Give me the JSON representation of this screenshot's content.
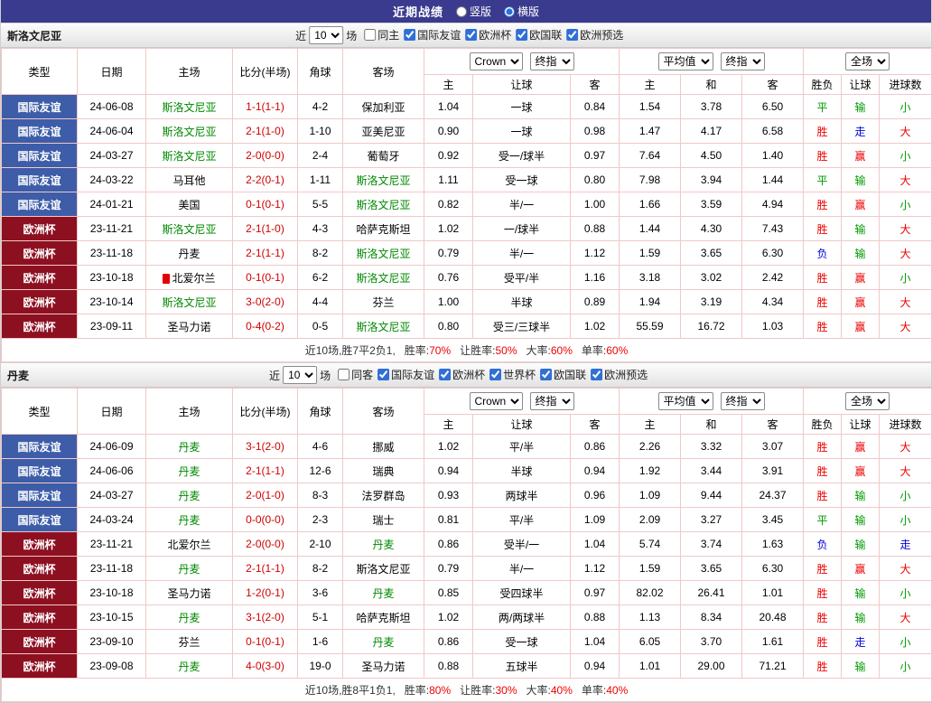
{
  "topbar": {
    "title": "近期战绩",
    "layout_options": [
      {
        "label": "竖版",
        "selected": false
      },
      {
        "label": "横版",
        "selected": true
      }
    ]
  },
  "table_header": {
    "col_type": "类型",
    "col_date": "日期",
    "col_home": "主场",
    "col_score": "比分(半场)",
    "col_corner": "角球",
    "col_away": "客场",
    "handicap_group": {
      "bookmaker": "Crown",
      "price_type": "终指",
      "sub_home": "主",
      "sub_line": "让球",
      "sub_away": "客"
    },
    "average_group": {
      "name": "平均值",
      "price_type": "终指",
      "sub_home": "主",
      "sub_draw": "和",
      "sub_away": "客"
    },
    "result_group": {
      "scope": "全场",
      "sub_wdl": "胜负",
      "sub_handicap": "让球",
      "sub_goals": "进球数"
    }
  },
  "colors": {
    "topbar_bg": "#3a3a8e",
    "badge_friendly": "#3d5da9",
    "badge_eurocup": "#8d1021",
    "focus_team": "#008800",
    "score": "#d10000",
    "win_red": "#ee0000",
    "lose_green": "#009900",
    "draw_blue": "#0000d9"
  },
  "sections": [
    {
      "team": "斯洛文尼亚",
      "filter": {
        "prefix": "近",
        "count": "10",
        "suffix": "场",
        "checkboxes": [
          {
            "label": "同主",
            "checked": false
          },
          {
            "label": "国际友谊",
            "checked": true
          },
          {
            "label": "欧洲杯",
            "checked": true
          },
          {
            "label": "欧国联",
            "checked": true
          },
          {
            "label": "欧洲预选",
            "checked": true
          }
        ]
      },
      "rows": [
        {
          "type": "国际友谊",
          "type_color": "blue",
          "date": "24-06-08",
          "home": "斯洛文尼亚",
          "home_focus": true,
          "score": "1-1(1-1)",
          "corners": "4-2",
          "away": "保加利亚",
          "away_focus": false,
          "crown_home": "1.04",
          "handicap": "一球",
          "crown_away": "0.84",
          "avg_home": "1.54",
          "avg_draw": "3.78",
          "avg_away": "6.50",
          "res_wdl": "平",
          "res_handicap": "输",
          "res_goals": "小"
        },
        {
          "type": "国际友谊",
          "type_color": "blue",
          "date": "24-06-04",
          "home": "斯洛文尼亚",
          "home_focus": true,
          "score": "2-1(1-0)",
          "corners": "1-10",
          "away": "亚美尼亚",
          "away_focus": false,
          "crown_home": "0.90",
          "handicap": "一球",
          "crown_away": "0.98",
          "avg_home": "1.47",
          "avg_draw": "4.17",
          "avg_away": "6.58",
          "res_wdl": "胜",
          "res_handicap": "走",
          "res_goals": "大"
        },
        {
          "type": "国际友谊",
          "type_color": "blue",
          "date": "24-03-27",
          "home": "斯洛文尼亚",
          "home_focus": true,
          "score": "2-0(0-0)",
          "corners": "2-4",
          "away": "葡萄牙",
          "away_focus": false,
          "crown_home": "0.92",
          "handicap": "受一/球半",
          "crown_away": "0.97",
          "avg_home": "7.64",
          "avg_draw": "4.50",
          "avg_away": "1.40",
          "res_wdl": "胜",
          "res_handicap": "赢",
          "res_goals": "小"
        },
        {
          "type": "国际友谊",
          "type_color": "blue",
          "date": "24-03-22",
          "home": "马耳他",
          "home_focus": false,
          "score": "2-2(0-1)",
          "corners": "1-11",
          "away": "斯洛文尼亚",
          "away_focus": true,
          "crown_home": "1.11",
          "handicap": "受一球",
          "crown_away": "0.80",
          "avg_home": "7.98",
          "avg_draw": "3.94",
          "avg_away": "1.44",
          "res_wdl": "平",
          "res_handicap": "输",
          "res_goals": "大"
        },
        {
          "type": "国际友谊",
          "type_color": "blue",
          "date": "24-01-21",
          "home": "美国",
          "home_focus": false,
          "score": "0-1(0-1)",
          "corners": "5-5",
          "away": "斯洛文尼亚",
          "away_focus": true,
          "crown_home": "0.82",
          "handicap": "半/一",
          "crown_away": "1.00",
          "avg_home": "1.66",
          "avg_draw": "3.59",
          "avg_away": "4.94",
          "res_wdl": "胜",
          "res_handicap": "赢",
          "res_goals": "小"
        },
        {
          "type": "欧洲杯",
          "type_color": "darkred",
          "date": "23-11-21",
          "home": "斯洛文尼亚",
          "home_focus": true,
          "score": "2-1(1-0)",
          "corners": "4-3",
          "away": "哈萨克斯坦",
          "away_focus": false,
          "crown_home": "1.02",
          "handicap": "一/球半",
          "crown_away": "0.88",
          "avg_home": "1.44",
          "avg_draw": "4.30",
          "avg_away": "7.43",
          "res_wdl": "胜",
          "res_handicap": "输",
          "res_goals": "大"
        },
        {
          "type": "欧洲杯",
          "type_color": "darkred",
          "date": "23-11-18",
          "home": "丹麦",
          "home_focus": false,
          "score": "2-1(1-1)",
          "corners": "8-2",
          "away": "斯洛文尼亚",
          "away_focus": true,
          "crown_home": "0.79",
          "handicap": "半/一",
          "crown_away": "1.12",
          "avg_home": "1.59",
          "avg_draw": "3.65",
          "avg_away": "6.30",
          "res_wdl": "负",
          "res_handicap": "输",
          "res_goals": "大"
        },
        {
          "type": "欧洲杯",
          "type_color": "darkred",
          "date": "23-10-18",
          "home": "北爱尔兰",
          "home_focus": false,
          "home_icon": "red-card",
          "score": "0-1(0-1)",
          "corners": "6-2",
          "away": "斯洛文尼亚",
          "away_focus": true,
          "crown_home": "0.76",
          "handicap": "受平/半",
          "crown_away": "1.16",
          "avg_home": "3.18",
          "avg_draw": "3.02",
          "avg_away": "2.42",
          "res_wdl": "胜",
          "res_handicap": "赢",
          "res_goals": "小"
        },
        {
          "type": "欧洲杯",
          "type_color": "darkred",
          "date": "23-10-14",
          "home": "斯洛文尼亚",
          "home_focus": true,
          "score": "3-0(2-0)",
          "corners": "4-4",
          "away": "芬兰",
          "away_focus": false,
          "crown_home": "1.00",
          "handicap": "半球",
          "crown_away": "0.89",
          "avg_home": "1.94",
          "avg_draw": "3.19",
          "avg_away": "4.34",
          "res_wdl": "胜",
          "res_handicap": "赢",
          "res_goals": "大"
        },
        {
          "type": "欧洲杯",
          "type_color": "darkred",
          "date": "23-09-11",
          "home": "圣马力诺",
          "home_focus": false,
          "score": "0-4(0-2)",
          "corners": "0-5",
          "away": "斯洛文尼亚",
          "away_focus": true,
          "crown_home": "0.80",
          "handicap": "受三/三球半",
          "crown_away": "1.02",
          "avg_home": "55.59",
          "avg_draw": "16.72",
          "avg_away": "1.03",
          "res_wdl": "胜",
          "res_handicap": "赢",
          "res_goals": "大"
        }
      ],
      "summary": {
        "prefix": "近10场,胜7平2负1,",
        "stats": [
          {
            "label": "胜率:",
            "value": "70%"
          },
          {
            "label": "让胜率:",
            "value": "50%"
          },
          {
            "label": "大率:",
            "value": "60%"
          },
          {
            "label": "单率:",
            "value": "60%"
          }
        ]
      }
    },
    {
      "team": "丹麦",
      "filter": {
        "prefix": "近",
        "count": "10",
        "suffix": "场",
        "checkboxes": [
          {
            "label": "同客",
            "checked": false
          },
          {
            "label": "国际友谊",
            "checked": true
          },
          {
            "label": "欧洲杯",
            "checked": true
          },
          {
            "label": "世界杯",
            "checked": true
          },
          {
            "label": "欧国联",
            "checked": true
          },
          {
            "label": "欧洲预选",
            "checked": true
          }
        ]
      },
      "rows": [
        {
          "type": "国际友谊",
          "type_color": "blue",
          "date": "24-06-09",
          "home": "丹麦",
          "home_focus": true,
          "score": "3-1(2-0)",
          "corners": "4-6",
          "away": "挪威",
          "away_focus": false,
          "crown_home": "1.02",
          "handicap": "平/半",
          "crown_away": "0.86",
          "avg_home": "2.26",
          "avg_draw": "3.32",
          "avg_away": "3.07",
          "res_wdl": "胜",
          "res_handicap": "赢",
          "res_goals": "大"
        },
        {
          "type": "国际友谊",
          "type_color": "blue",
          "date": "24-06-06",
          "home": "丹麦",
          "home_focus": true,
          "score": "2-1(1-1)",
          "corners": "12-6",
          "away": "瑞典",
          "away_focus": false,
          "crown_home": "0.94",
          "handicap": "半球",
          "crown_away": "0.94",
          "avg_home": "1.92",
          "avg_draw": "3.44",
          "avg_away": "3.91",
          "res_wdl": "胜",
          "res_handicap": "赢",
          "res_goals": "大"
        },
        {
          "type": "国际友谊",
          "type_color": "blue",
          "date": "24-03-27",
          "home": "丹麦",
          "home_focus": true,
          "score": "2-0(1-0)",
          "corners": "8-3",
          "away": "法罗群岛",
          "away_focus": false,
          "crown_home": "0.93",
          "handicap": "两球半",
          "crown_away": "0.96",
          "avg_home": "1.09",
          "avg_draw": "9.44",
          "avg_away": "24.37",
          "res_wdl": "胜",
          "res_handicap": "输",
          "res_goals": "小"
        },
        {
          "type": "国际友谊",
          "type_color": "blue",
          "date": "24-03-24",
          "home": "丹麦",
          "home_focus": true,
          "score": "0-0(0-0)",
          "corners": "2-3",
          "away": "瑞士",
          "away_focus": false,
          "crown_home": "0.81",
          "handicap": "平/半",
          "crown_away": "1.09",
          "avg_home": "2.09",
          "avg_draw": "3.27",
          "avg_away": "3.45",
          "res_wdl": "平",
          "res_handicap": "输",
          "res_goals": "小"
        },
        {
          "type": "欧洲杯",
          "type_color": "darkred",
          "date": "23-11-21",
          "home": "北爱尔兰",
          "home_focus": false,
          "score": "2-0(0-0)",
          "corners": "2-10",
          "away": "丹麦",
          "away_focus": true,
          "crown_home": "0.86",
          "handicap": "受半/一",
          "crown_away": "1.04",
          "avg_home": "5.74",
          "avg_draw": "3.74",
          "avg_away": "1.63",
          "res_wdl": "负",
          "res_handicap": "输",
          "res_goals": "走"
        },
        {
          "type": "欧洲杯",
          "type_color": "darkred",
          "date": "23-11-18",
          "home": "丹麦",
          "home_focus": true,
          "score": "2-1(1-1)",
          "corners": "8-2",
          "away": "斯洛文尼亚",
          "away_focus": false,
          "crown_home": "0.79",
          "handicap": "半/一",
          "crown_away": "1.12",
          "avg_home": "1.59",
          "avg_draw": "3.65",
          "avg_away": "6.30",
          "res_wdl": "胜",
          "res_handicap": "赢",
          "res_goals": "大"
        },
        {
          "type": "欧洲杯",
          "type_color": "darkred",
          "date": "23-10-18",
          "home": "圣马力诺",
          "home_focus": false,
          "score": "1-2(0-1)",
          "corners": "3-6",
          "away": "丹麦",
          "away_focus": true,
          "crown_home": "0.85",
          "handicap": "受四球半",
          "crown_away": "0.97",
          "avg_home": "82.02",
          "avg_draw": "26.41",
          "avg_away": "1.01",
          "res_wdl": "胜",
          "res_handicap": "输",
          "res_goals": "小"
        },
        {
          "type": "欧洲杯",
          "type_color": "darkred",
          "date": "23-10-15",
          "home": "丹麦",
          "home_focus": true,
          "score": "3-1(2-0)",
          "corners": "5-1",
          "away": "哈萨克斯坦",
          "away_focus": false,
          "crown_home": "1.02",
          "handicap": "两/两球半",
          "crown_away": "0.88",
          "avg_home": "1.13",
          "avg_draw": "8.34",
          "avg_away": "20.48",
          "res_wdl": "胜",
          "res_handicap": "输",
          "res_goals": "大"
        },
        {
          "type": "欧洲杯",
          "type_color": "darkred",
          "date": "23-09-10",
          "home": "芬兰",
          "home_focus": false,
          "score": "0-1(0-1)",
          "corners": "1-6",
          "away": "丹麦",
          "away_focus": true,
          "crown_home": "0.86",
          "handicap": "受一球",
          "crown_away": "1.04",
          "avg_home": "6.05",
          "avg_draw": "3.70",
          "avg_away": "1.61",
          "res_wdl": "胜",
          "res_handicap": "走",
          "res_goals": "小"
        },
        {
          "type": "欧洲杯",
          "type_color": "darkred",
          "date": "23-09-08",
          "home": "丹麦",
          "home_focus": true,
          "score": "4-0(3-0)",
          "corners": "19-0",
          "away": "圣马力诺",
          "away_focus": false,
          "crown_home": "0.88",
          "handicap": "五球半",
          "crown_away": "0.94",
          "avg_home": "1.01",
          "avg_draw": "29.00",
          "avg_away": "71.21",
          "res_wdl": "胜",
          "res_handicap": "输",
          "res_goals": "小"
        }
      ],
      "summary": {
        "prefix": "近10场,胜8平1负1,",
        "stats": [
          {
            "label": "胜率:",
            "value": "80%"
          },
          {
            "label": "让胜率:",
            "value": "30%"
          },
          {
            "label": "大率:",
            "value": "40%"
          },
          {
            "label": "单率:",
            "value": "40%"
          }
        ]
      }
    }
  ]
}
